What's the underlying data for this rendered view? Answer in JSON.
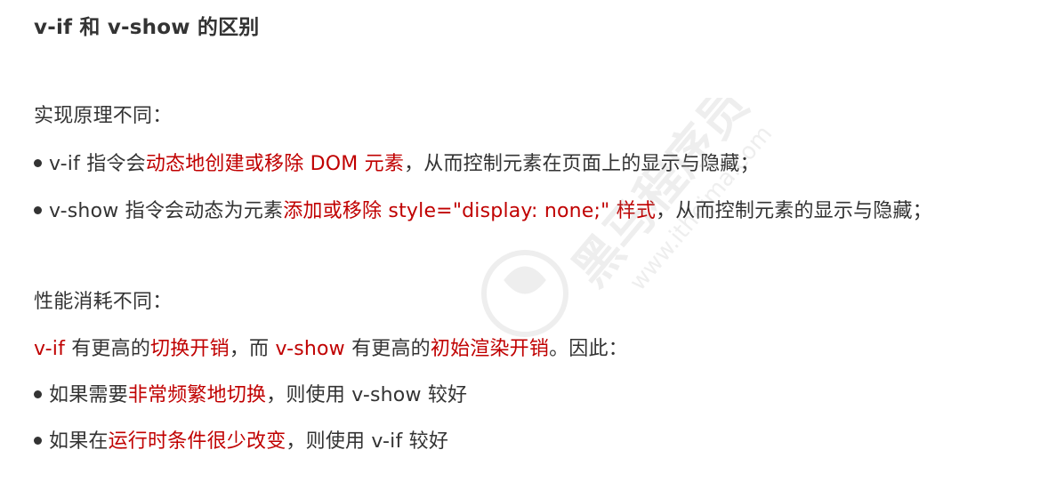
{
  "title": "v-if 和 v-show 的区别",
  "section1": {
    "heading": "实现原理不同：",
    "bullet1": {
      "text_a": "v-if 指令会",
      "highlight": "动态地创建或移除 DOM 元素",
      "text_b": "，从而控制元素在页面上的显示与隐藏；"
    },
    "bullet2": {
      "text_a": "v-show 指令会动态为元素",
      "highlight": "添加或移除 style=\"display: none;\" 样式",
      "text_b": "，从而控制元素的显示与隐藏；"
    }
  },
  "section2": {
    "heading": "性能消耗不同：",
    "summary": {
      "hl1": "v-if",
      "t1": " 有更高的",
      "hl2": "切换开销",
      "t2": "，而 ",
      "hl3": "v-show",
      "t3": " 有更高的",
      "hl4": "初始渲染开销",
      "t4": "。因此："
    },
    "bullet1": {
      "text_a": "如果需要",
      "highlight": "非常频繁地切换",
      "text_b": "，则使用 v-show 较好"
    },
    "bullet2": {
      "text_a": "如果在",
      "highlight": "运行时条件很少改变",
      "text_b": "，则使用 v-if 较好"
    }
  },
  "watermark": {
    "brand": "黑马程序员",
    "url": "www.itheima.com"
  },
  "colors": {
    "text": "#333333",
    "highlight": "#c00000"
  }
}
